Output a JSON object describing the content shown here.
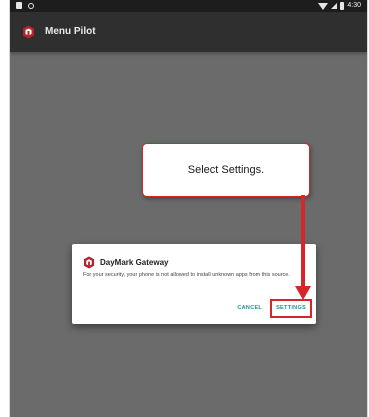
{
  "status_bar": {
    "time": "4:30",
    "icons": [
      "notification-icon",
      "sync-icon",
      "wifi-icon",
      "signal-icon",
      "battery-icon"
    ]
  },
  "app_bar": {
    "title": "Menu Pilot",
    "logo_icon": "menu-pilot-logo-icon"
  },
  "callout": {
    "text": "Select Settings."
  },
  "dialog": {
    "app_name": "DayMark Gateway",
    "logo_icon": "daymark-logo-icon",
    "message": "For your security, your phone is not allowed to install unknown apps from this source.",
    "cancel_label": "CANCEL",
    "settings_label": "SETTINGS"
  },
  "colors": {
    "screen_background": "#6b6b6b",
    "app_bar": "#2f2f2f",
    "status_bar": "#1d1d1d",
    "brand_red": "#b4242c",
    "highlight_red": "#d6262a",
    "button_teal": "#17988d"
  }
}
